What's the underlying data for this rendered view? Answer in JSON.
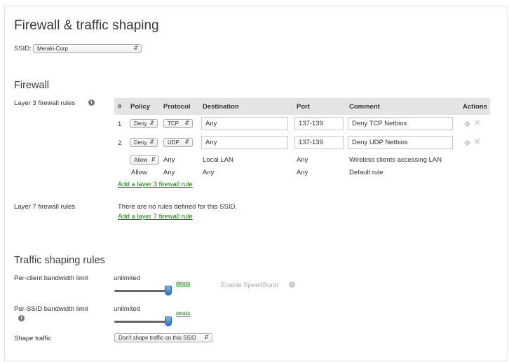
{
  "page": {
    "title": "Firewall & traffic shaping",
    "ssid_label": "SSID:",
    "ssid_value": "Meraki-Corp"
  },
  "firewall": {
    "heading": "Firewall",
    "l3_label": "Layer 3 firewall rules",
    "columns": [
      "#",
      "Policy",
      "Protocol",
      "Destination",
      "Port",
      "Comment",
      "Actions"
    ],
    "rules": [
      {
        "num": "1",
        "policy": "Deny",
        "protocol": "TCP",
        "destination": "Any",
        "port": "137-139",
        "comment": "Deny TCP Netbios"
      },
      {
        "num": "2",
        "policy": "Deny",
        "protocol": "UDP",
        "destination": "Any",
        "port": "137-139",
        "comment": "Deny UDP Netbios"
      }
    ],
    "lan_rule": {
      "policy": "Allow",
      "protocol": "Any",
      "destination": "Local LAN",
      "port": "Any",
      "comment": "Wireless clients accessing LAN"
    },
    "default_rule": {
      "policy": "Allow",
      "protocol": "Any",
      "destination": "Any",
      "port": "Any",
      "comment": "Default rule"
    },
    "add_l3_link": "Add a layer 3 firewall rule",
    "l7_label": "Layer 7 firewall rules",
    "l7_empty": "There are no rules defined for this SSID.",
    "add_l7_link": "Add a layer 7 firewall rule"
  },
  "traffic": {
    "heading": "Traffic shaping rules",
    "per_client_label": "Per-client bandwidth limit",
    "per_client_value": "unlimited",
    "per_ssid_label": "Per-SSID bandwidth limit",
    "per_ssid_value": "unlimited",
    "details_link": "details",
    "speedburst_label": "Enable SpeedBurst",
    "shape_label": "Shape traffic",
    "shape_value": "Don't shape traffic on this SSID",
    "per_client_slider_fraction": 1.0,
    "per_ssid_slider_fraction": 1.0
  },
  "icons": {
    "info": "info-icon",
    "drag": "move-icon",
    "delete": "close-icon"
  }
}
